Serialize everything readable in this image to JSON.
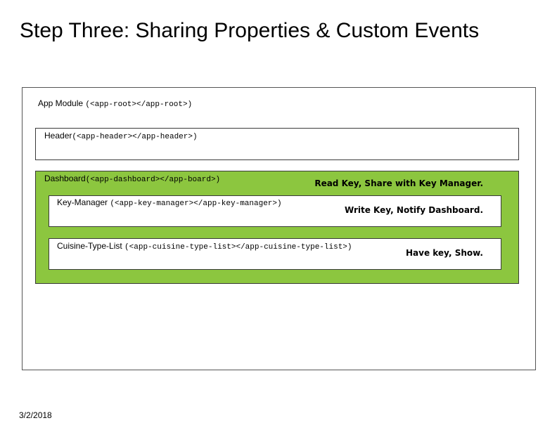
{
  "title": "Step Three: Sharing Properties & Custom Events",
  "app_module": {
    "name": "App Module ",
    "tag": "(<app-root></app-root>)"
  },
  "header": {
    "name": "Header",
    "tag": "(<app-header></app-header>)"
  },
  "dashboard": {
    "name": "Dashboard",
    "tag": "(<app-dashboard></app-board>)",
    "note": "Read Key, Share with Key Manager.",
    "color": "#8cc63f"
  },
  "key_manager": {
    "name": "Key-Manager ",
    "tag": "(<app-key-manager></app-key-manager>)",
    "note": "Write Key, Notify Dashboard."
  },
  "cuisine_type_list": {
    "name": "Cuisine-Type-List ",
    "tag": "(<app-cuisine-type-list></app-cuisine-type-list>)",
    "note": "Have key, Show."
  },
  "date": "3/2/2018"
}
